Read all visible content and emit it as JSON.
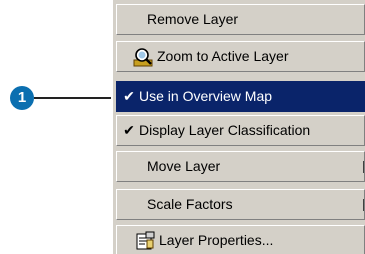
{
  "callout": {
    "number": "1"
  },
  "menu": {
    "items": [
      {
        "label": "Remove Layer",
        "icon": "",
        "checked": false,
        "selected": false,
        "submenu": false
      },
      {
        "label": "Zoom to Active Layer",
        "icon": "zoom-magnifier-icon",
        "checked": false,
        "selected": false,
        "submenu": false
      },
      {
        "label": "Use in Overview Map",
        "icon": "",
        "checked": true,
        "selected": true,
        "submenu": false
      },
      {
        "label": "Display Layer Classification",
        "icon": "",
        "checked": true,
        "selected": false,
        "submenu": false
      },
      {
        "label": "Move Layer",
        "icon": "",
        "checked": false,
        "selected": false,
        "submenu": true
      },
      {
        "label": "Scale Factors",
        "icon": "",
        "checked": false,
        "selected": false,
        "submenu": true
      },
      {
        "label": "Layer Properties...",
        "icon": "layer-properties-icon",
        "checked": false,
        "selected": false,
        "submenu": false
      }
    ],
    "check_glyph": "✔"
  },
  "colors": {
    "menu_bg": "#d4d0c8",
    "selected_bg": "#0a246a",
    "callout": "#0b6fb0"
  }
}
